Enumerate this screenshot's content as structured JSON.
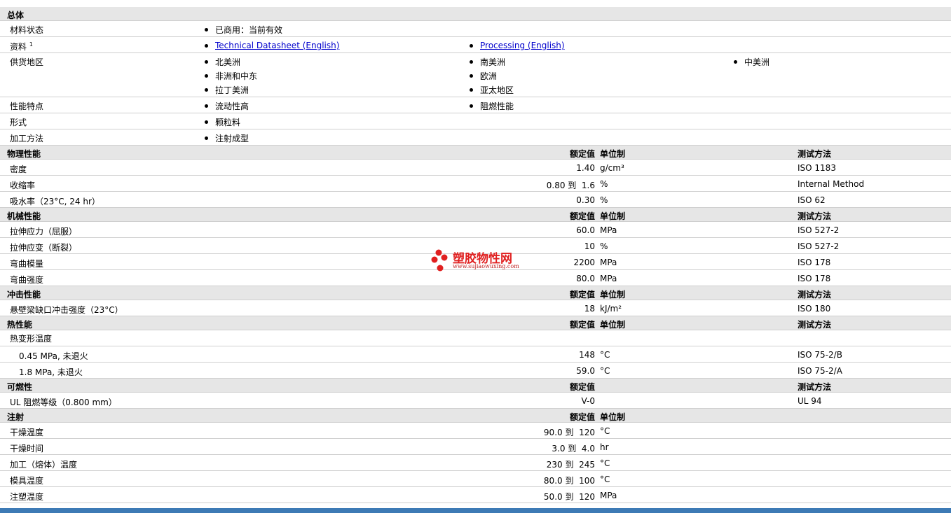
{
  "general": {
    "header": "总体",
    "status_label": "材料状态",
    "status_value": "已商用：当前有效",
    "docs_label": "资料",
    "docs_sup": "1",
    "doc_link_1": "Technical Datasheet (English)",
    "doc_link_2": "Processing (English)",
    "region_label": "供货地区",
    "regions": [
      "北美洲",
      "非洲和中东",
      "拉丁美洲",
      "南美洲",
      "欧洲",
      "亚太地区",
      "中美洲"
    ],
    "features_label": "性能特点",
    "features": [
      "流动性高",
      "阻燃性能"
    ],
    "form_label": "形式",
    "form_value": "颗粒料",
    "process_label": "加工方法",
    "process_value": "注射成型"
  },
  "columns": {
    "value": "额定值",
    "unit": "单位制",
    "test": "测试方法"
  },
  "sections": {
    "physical": {
      "title": "物理性能",
      "rows": [
        {
          "name": "密度",
          "value": "1.40",
          "unit": "g/cm³",
          "test": "ISO 1183"
        },
        {
          "name": "收缩率",
          "value": "0.80 到  1.6",
          "unit": "%",
          "test": "Internal Method"
        },
        {
          "name": "吸水率（23°C, 24 hr）",
          "value": "0.30",
          "unit": "%",
          "test": "ISO 62"
        }
      ]
    },
    "mechanical": {
      "title": "机械性能",
      "rows": [
        {
          "name": "拉伸应力（屈服）",
          "value": "60.0",
          "unit": "MPa",
          "test": "ISO 527-2"
        },
        {
          "name": "拉伸应变（断裂）",
          "value": "10",
          "unit": "%",
          "test": "ISO 527-2"
        },
        {
          "name": "弯曲模量",
          "value": "2200",
          "unit": "MPa",
          "test": "ISO 178"
        },
        {
          "name": "弯曲强度",
          "value": "80.0",
          "unit": "MPa",
          "test": "ISO 178"
        }
      ]
    },
    "impact": {
      "title": "冲击性能",
      "rows": [
        {
          "name": "悬壁梁缺口冲击强度（23°C）",
          "value": "18",
          "unit": "kJ/m²",
          "test": "ISO 180"
        }
      ]
    },
    "thermal": {
      "title": "热性能",
      "group": "热变形温度",
      "rows": [
        {
          "name": "0.45 MPa, 未退火",
          "value": "148",
          "unit": "°C",
          "test": "ISO 75-2/B"
        },
        {
          "name": "1.8 MPa, 未退火",
          "value": "59.0",
          "unit": "°C",
          "test": "ISO 75-2/A"
        }
      ]
    },
    "flammability": {
      "title": "可燃性",
      "rows": [
        {
          "name": "UL 阻燃等级（0.800 mm）",
          "value": "V-0",
          "unit": "",
          "test": "UL 94"
        }
      ]
    },
    "injection": {
      "title": "注射",
      "rows": [
        {
          "name": "干燥温度",
          "value": "90.0 到  120",
          "unit": "°C"
        },
        {
          "name": "干燥时间",
          "value": "3.0 到  4.0",
          "unit": "hr"
        },
        {
          "name": "加工（熔体）温度",
          "value": "230 到  245",
          "unit": "°C"
        },
        {
          "name": "模具温度",
          "value": "80.0 到  100",
          "unit": "°C"
        },
        {
          "name": "注塑温度",
          "value": "50.0 到  120",
          "unit": "MPa"
        }
      ]
    }
  },
  "watermark": {
    "name": "塑胶物性网",
    "url": "www.sujiaowuxing.com"
  },
  "colors": {
    "header_bg": "#e6e6e6",
    "link": "#0000cc",
    "watermark": "#e02020",
    "bottom_bar": "#3d7ab5"
  }
}
